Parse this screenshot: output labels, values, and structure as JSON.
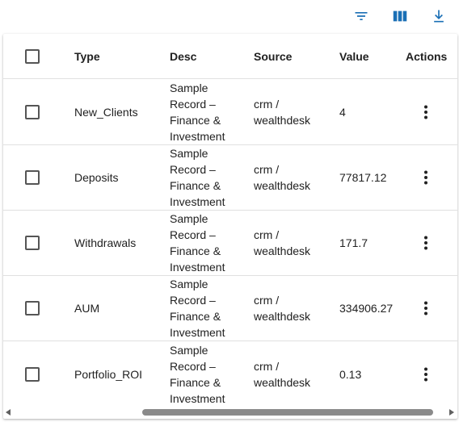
{
  "toolbar": {
    "filter_icon": "filter-list-icon",
    "columns_icon": "view-columns-icon",
    "download_icon": "download-icon",
    "accent_color": "#1a6fb5"
  },
  "table": {
    "headers": {
      "type": "Type",
      "desc": "Desc",
      "source": "Source",
      "value": "Value",
      "actions": "Actions"
    },
    "rows": [
      {
        "type": "New_Clients",
        "desc": "Sample Record – Finance & Investment",
        "source": "crm / wealthdesk",
        "value": "4"
      },
      {
        "type": "Deposits",
        "desc": "Sample Record – Finance & Investment",
        "source": "crm / wealthdesk",
        "value": "77817.12"
      },
      {
        "type": "Withdrawals",
        "desc": "Sample Record – Finance & Investment",
        "source": "crm / wealthdesk",
        "value": "171.7"
      },
      {
        "type": "AUM",
        "desc": "Sample Record – Finance & Investment",
        "source": "crm / wealthdesk",
        "value": "334906.27"
      },
      {
        "type": "Portfolio_ROI",
        "desc": "Sample Record – Finance & Investment",
        "source": "crm / wealthdesk",
        "value": "0.13"
      }
    ]
  }
}
